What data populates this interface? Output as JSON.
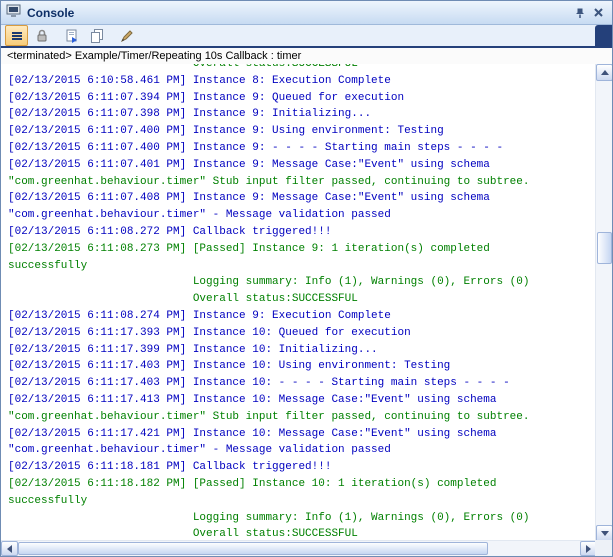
{
  "colors": {
    "log_blue": "#0000bf",
    "log_green": "#008000"
  },
  "title_bar": {
    "title": "Console",
    "view_icon": "console-icon",
    "buttons": [
      {
        "icon": "pin-icon"
      },
      {
        "icon": "close-icon",
        "glyph": "×"
      }
    ]
  },
  "toolbar": {
    "buttons": [
      {
        "icon": "menu-icon",
        "state": "active"
      },
      {
        "icon": "scroll-lock-icon"
      },
      {
        "icon": "open-log-icon"
      },
      {
        "icon": "copy-icon"
      },
      {
        "icon": "clear-console-icon"
      }
    ]
  },
  "status_line": {
    "text": "<terminated> Example/Timer/Repeating 10s Callback : timer"
  },
  "console": {
    "lines": [
      {
        "text": "                            Overall status:SUCCESSFUL",
        "color": "green"
      },
      {
        "text": "[02/13/2015 6:10:58.461 PM] Instance 8: Execution Complete",
        "color": "blue"
      },
      {
        "text": "[02/13/2015 6:11:07.394 PM] Instance 9: Queued for execution",
        "color": "blue"
      },
      {
        "text": "[02/13/2015 6:11:07.398 PM] Instance 9: Initializing...",
        "color": "blue"
      },
      {
        "text": "[02/13/2015 6:11:07.400 PM] Instance 9: Using environment: Testing",
        "color": "blue"
      },
      {
        "text": "[02/13/2015 6:11:07.400 PM] Instance 9: - - - - Starting main steps - - - -",
        "color": "blue"
      },
      {
        "text": "[02/13/2015 6:11:07.401 PM] Instance 9: Message Case:\"Event\" using schema",
        "color": "blue"
      },
      {
        "text": "\"com.greenhat.behaviour.timer\" Stub input filter passed, continuing to subtree.",
        "color": "green"
      },
      {
        "text": "[02/13/2015 6:11:07.408 PM] Instance 9: Message Case:\"Event\" using schema",
        "color": "blue"
      },
      {
        "text": "\"com.greenhat.behaviour.timer\" - Message validation passed",
        "color": "blue"
      },
      {
        "text": "[02/13/2015 6:11:08.272 PM] Callback triggered!!!",
        "color": "blue"
      },
      {
        "text": "[02/13/2015 6:11:08.273 PM] [Passed] Instance 9: 1 iteration(s) completed",
        "color": "green"
      },
      {
        "text": "successfully",
        "color": "green"
      },
      {
        "text": "                            Logging summary: Info (1), Warnings (0), Errors (0)",
        "color": "green"
      },
      {
        "text": "                            Overall status:SUCCESSFUL",
        "color": "green"
      },
      {
        "text": "[02/13/2015 6:11:08.274 PM] Instance 9: Execution Complete",
        "color": "blue"
      },
      {
        "text": "[02/13/2015 6:11:17.393 PM] Instance 10: Queued for execution",
        "color": "blue"
      },
      {
        "text": "[02/13/2015 6:11:17.399 PM] Instance 10: Initializing...",
        "color": "blue"
      },
      {
        "text": "[02/13/2015 6:11:17.403 PM] Instance 10: Using environment: Testing",
        "color": "blue"
      },
      {
        "text": "[02/13/2015 6:11:17.403 PM] Instance 10: - - - - Starting main steps - - - -",
        "color": "blue"
      },
      {
        "text": "[02/13/2015 6:11:17.413 PM] Instance 10: Message Case:\"Event\" using schema",
        "color": "blue"
      },
      {
        "text": "\"com.greenhat.behaviour.timer\" Stub input filter passed, continuing to subtree.",
        "color": "green"
      },
      {
        "text": "[02/13/2015 6:11:17.421 PM] Instance 10: Message Case:\"Event\" using schema",
        "color": "blue"
      },
      {
        "text": "\"com.greenhat.behaviour.timer\" - Message validation passed",
        "color": "blue"
      },
      {
        "text": "[02/13/2015 6:11:18.181 PM] Callback triggered!!!",
        "color": "blue"
      },
      {
        "text": "[02/13/2015 6:11:18.182 PM] [Passed] Instance 10: 1 iteration(s) completed",
        "color": "green"
      },
      {
        "text": "successfully",
        "color": "green"
      },
      {
        "text": "                            Logging summary: Info (1), Warnings (0), Errors (0)",
        "color": "green"
      },
      {
        "text": "                            Overall status:SUCCESSFUL",
        "color": "green"
      }
    ]
  }
}
